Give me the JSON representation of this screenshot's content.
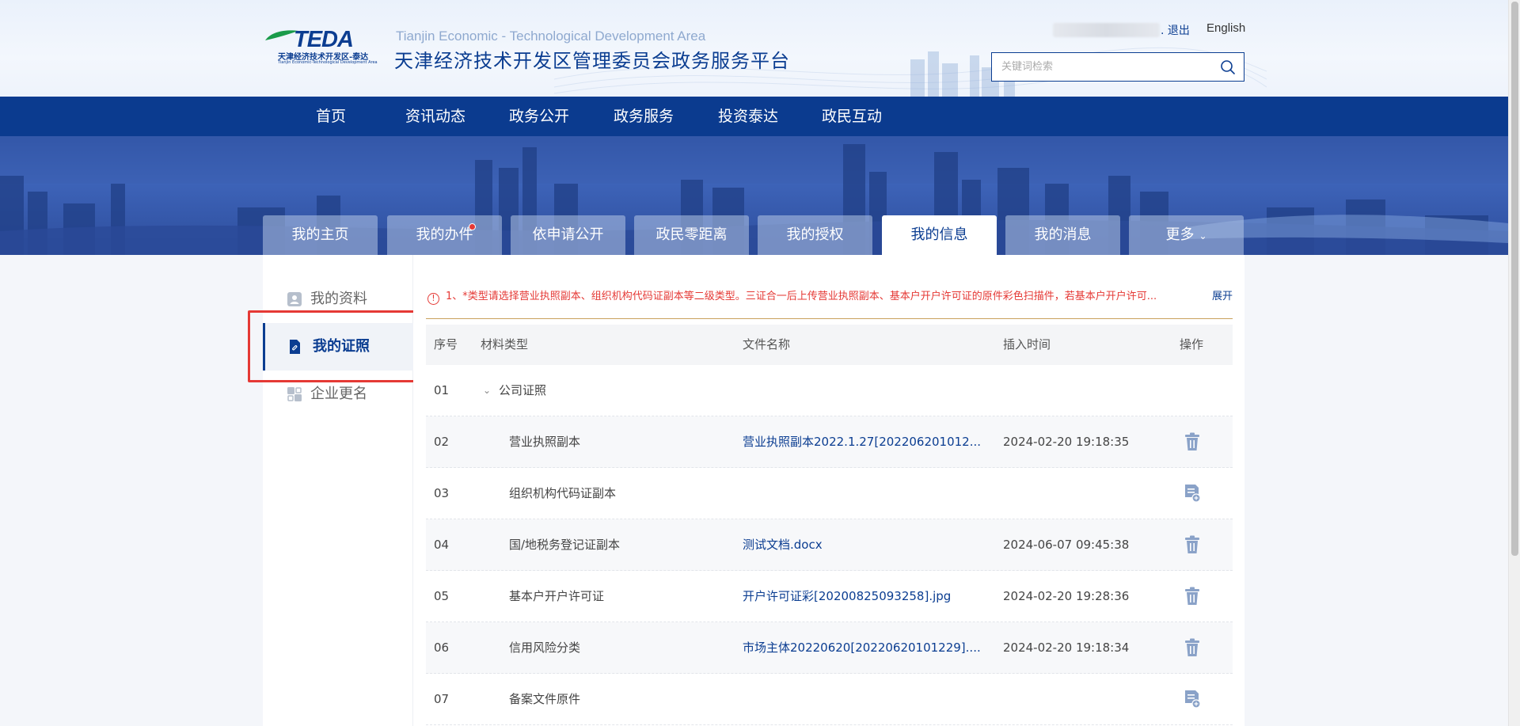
{
  "header": {
    "logo_text": "TEDA",
    "logo_cn": "天津经济技术开发区-泰达",
    "logo_en": "Tianjin Economic-Technological Development Area",
    "site_title_en": "Tianjin Economic - Technological Development Area",
    "site_title_cn": "天津经济技术开发区管理委员会政务服务平台",
    "logout": ". 退出",
    "english": "English",
    "search_placeholder": "关键词检索"
  },
  "nav": [
    "首页",
    "资讯动态",
    "政务公开",
    "政务服务",
    "投资泰达",
    "政民互动"
  ],
  "tabs": [
    {
      "label": "我的主页"
    },
    {
      "label": "我的办件",
      "badge": true
    },
    {
      "label": "依申请公开"
    },
    {
      "label": "政民零距离"
    },
    {
      "label": "我的授权"
    },
    {
      "label": "我的信息",
      "active": true
    },
    {
      "label": "我的消息"
    },
    {
      "label": "更多",
      "chevron": "⌄"
    }
  ],
  "sidebar": [
    {
      "label": "我的资料",
      "icon": "profile-icon"
    },
    {
      "label": "我的证照",
      "icon": "license-icon",
      "active": true
    },
    {
      "label": "企业更名",
      "icon": "rename-icon"
    }
  ],
  "notice": {
    "text": "1、*类型请选择营业执照副本、组织机构代码证副本等二级类型。三证合一后上传营业执照副本、基本户开户许可证的原件彩色扫描件，若基本户开户许可...",
    "expand": "展开"
  },
  "table": {
    "headers": [
      "序号",
      "材料类型",
      "文件名称",
      "插入时间",
      "操作"
    ],
    "rows": [
      {
        "no": "01",
        "type": "公司证照",
        "file": "",
        "time": "",
        "action": "",
        "group": true
      },
      {
        "no": "02",
        "type": "营业执照副本",
        "file": "营业执照副本2022.1.27[202206201012...",
        "time": "2024-02-20 19:18:35",
        "action": "delete"
      },
      {
        "no": "03",
        "type": "组织机构代码证副本",
        "file": "",
        "time": "",
        "action": "upload"
      },
      {
        "no": "04",
        "type": "国/地税务登记证副本",
        "file": "测试文档.docx",
        "time": "2024-06-07 09:45:38",
        "action": "delete"
      },
      {
        "no": "05",
        "type": "基本户开户许可证",
        "file": "开户许可证彩[20200825093258].jpg",
        "time": "2024-02-20 19:28:36",
        "action": "delete"
      },
      {
        "no": "06",
        "type": "信用风险分类",
        "file": "市场主体20220620[20220620101229]....",
        "time": "2024-02-20 19:18:34",
        "action": "delete"
      },
      {
        "no": "07",
        "type": "备案文件原件",
        "file": "",
        "time": "",
        "action": "upload"
      }
    ]
  },
  "colors": {
    "primary": "#0b3b8f",
    "alert": "#e53935",
    "highlight_box": "#e53935"
  }
}
